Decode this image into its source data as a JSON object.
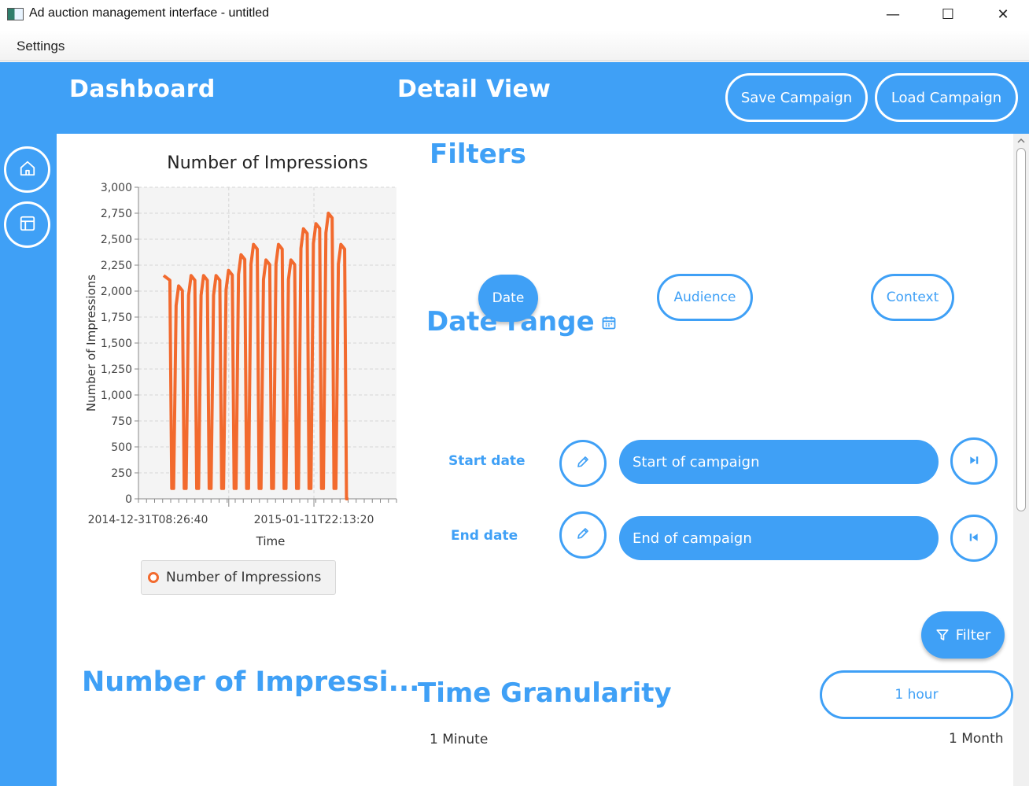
{
  "window": {
    "title": "Ad auction management interface - untitled",
    "minimize_glyph": "—",
    "maximize_glyph": "☐",
    "close_glyph": "✕"
  },
  "menu": {
    "items": [
      "Settings"
    ]
  },
  "header": {
    "tabs": [
      "Dashboard",
      "Detail View"
    ],
    "save_label": "Save Campaign",
    "load_label": "Load Campaign"
  },
  "sidebar": {
    "icons": [
      "home-icon",
      "layout-icon"
    ]
  },
  "chart_data": {
    "type": "line",
    "title": "Number of Impressions",
    "xlabel": "Time",
    "ylabel": "Number of Impressions",
    "ylim": [
      0,
      3000
    ],
    "yticks": [
      "0",
      "250",
      "500",
      "750",
      "1,000",
      "1,250",
      "1,500",
      "1,750",
      "2,000",
      "2,250",
      "2,500",
      "2,750",
      "3,000"
    ],
    "xtick_labels": [
      "2014-12-31T08:26:40",
      "2015-01-11T22:13:20"
    ],
    "grid": true,
    "legend": "bottom",
    "series": [
      {
        "name": "Number of Impressions",
        "color": "#f26a2e",
        "peaks": [
          2150,
          2050,
          2150,
          2150,
          2150,
          2200,
          2350,
          2450,
          2300,
          2450,
          2300,
          2600,
          2650,
          2750,
          2450
        ],
        "troughs": [
          100,
          100,
          100,
          100,
          100,
          100,
          100,
          100,
          100,
          100,
          100,
          100,
          100,
          100,
          0
        ]
      }
    ]
  },
  "legend": {
    "label": "Number of Impressions",
    "color": "#f26a2e"
  },
  "metric_title": "Number of Impressi...",
  "filters": {
    "heading": "Filters",
    "options": [
      "Date",
      "Audience",
      "Context"
    ],
    "selected": "Date"
  },
  "date_range": {
    "heading": "Date range",
    "start_label": "Start date",
    "start_value": "Start of campaign",
    "end_label": "End date",
    "end_value": "End of campaign"
  },
  "filter_button": "Filter",
  "granularity": {
    "heading": "Time Granularity",
    "value": "1 hour",
    "min_label": "1 Minute",
    "max_label": "1 Month",
    "slider_position": 0.25
  },
  "colors": {
    "accent": "#3fa0f6",
    "series": "#f26a2e"
  }
}
